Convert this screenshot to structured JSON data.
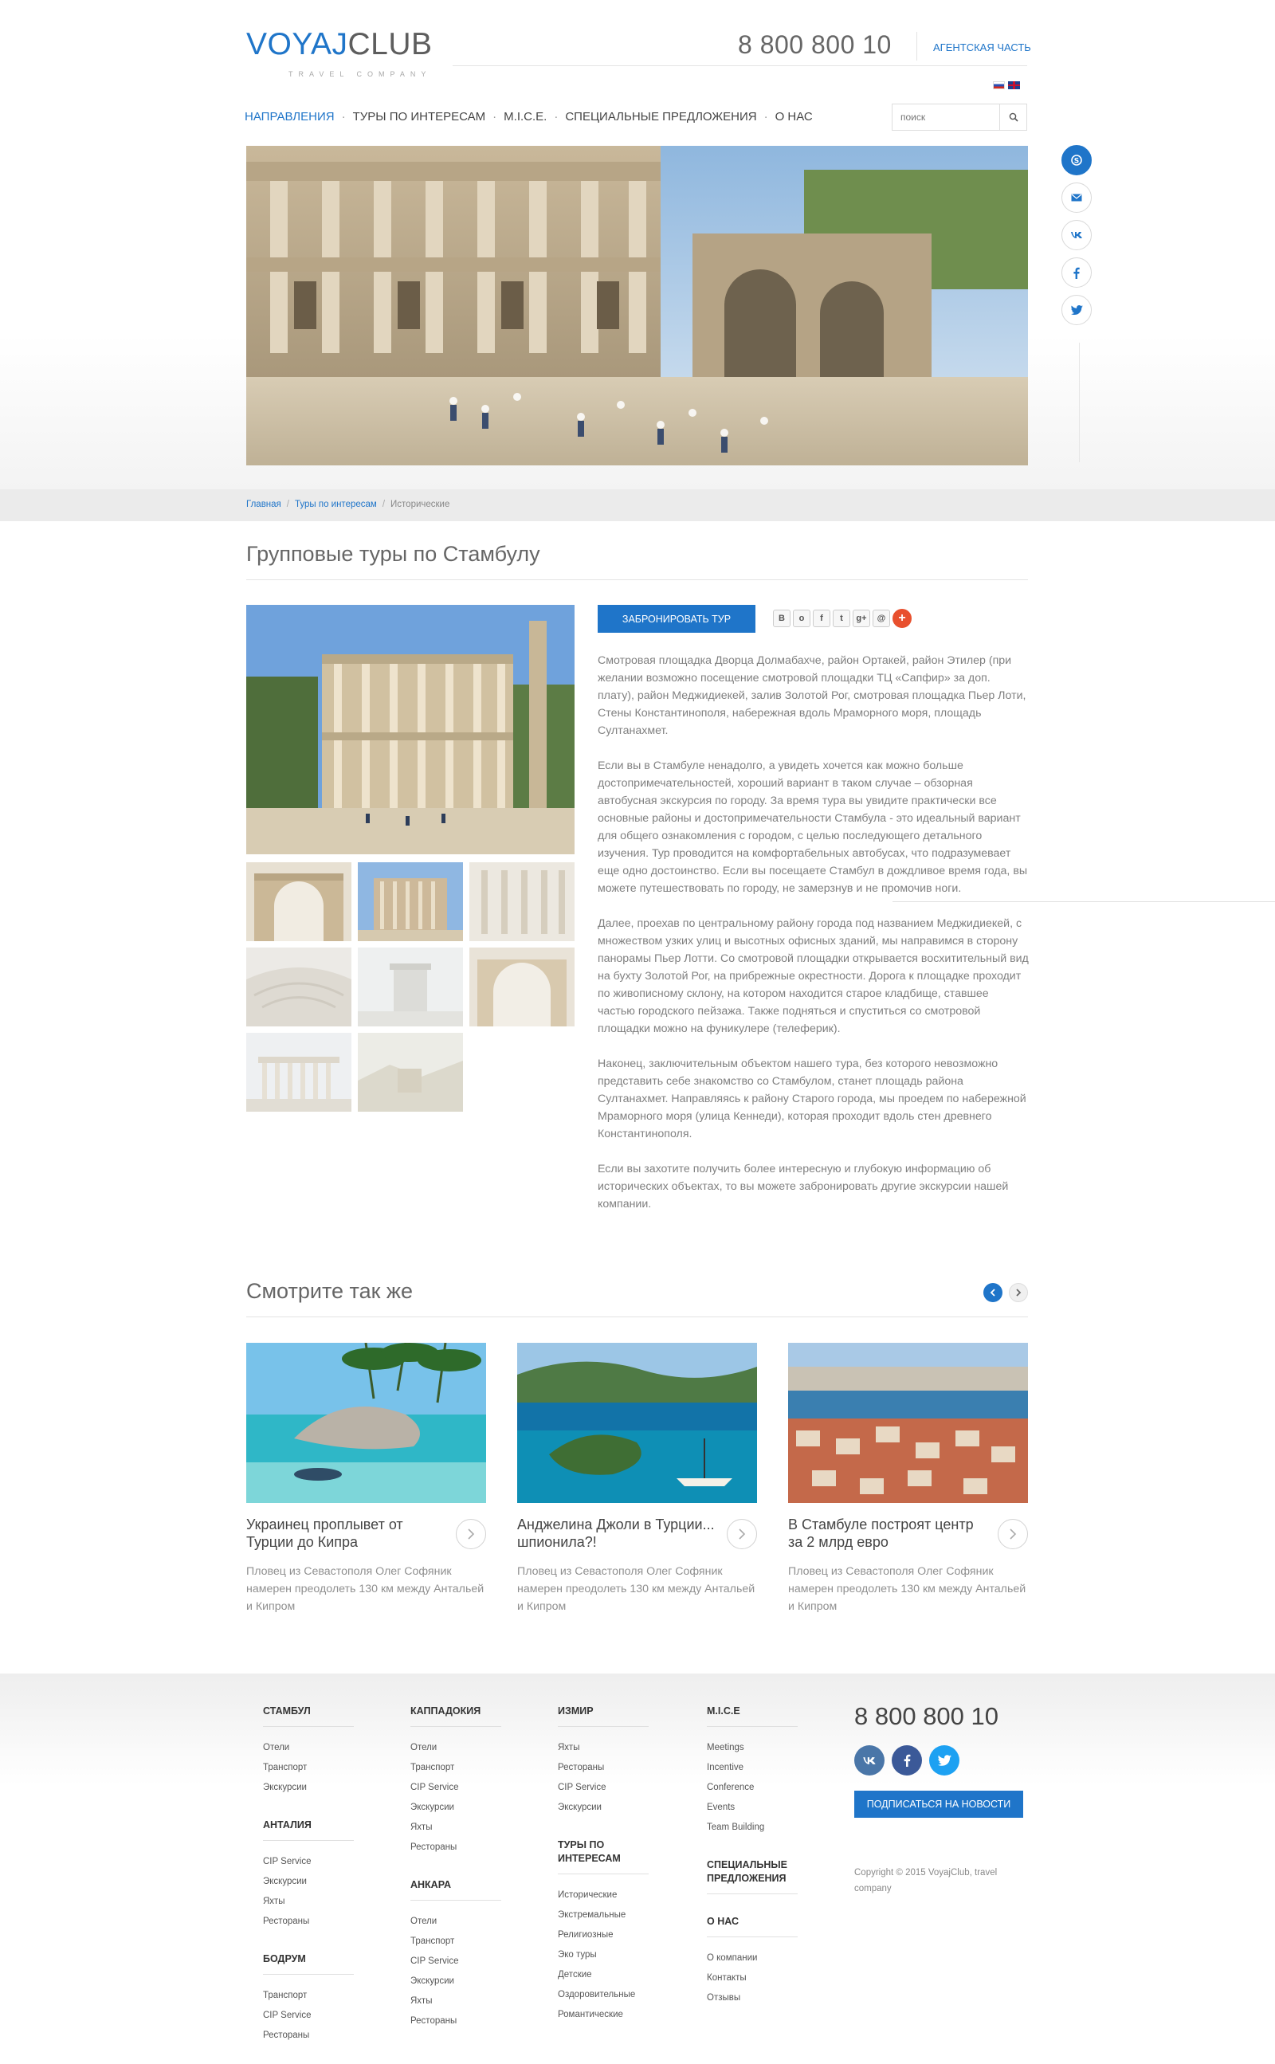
{
  "header": {
    "logo_left": "VOYAJ",
    "logo_right": "CLUB",
    "tagline": "TRAVEL COMPANY",
    "phone": "8 800 800 10",
    "agent_link": "Агентская часть"
  },
  "nav": {
    "items": [
      {
        "label": "Направления",
        "active": true
      },
      {
        "label": "Туры по интересам"
      },
      {
        "label": "M.I.C.E."
      },
      {
        "label": "Специальные предложения"
      },
      {
        "label": "О нас"
      }
    ],
    "search_placeholder": "поиск"
  },
  "breadcrumbs": {
    "home": "Главная",
    "section": "Туры по интересам",
    "current": "Исторические"
  },
  "page": {
    "title": "Групповые туры по Стамбулу",
    "book_button": "Забронировать тур",
    "share_buttons": [
      "В",
      "о",
      "f",
      "t",
      "g+",
      "@",
      "+"
    ],
    "paragraphs": [
      "Смотровая площадка Дворца Долмабахче, район Ортакей, район Этилер (при желании возможно посещение смотровой площадки ТЦ «Сапфир» за доп. плату), район Меджидиекей, залив Золотой Рог, смотровая площадка Пьер Лоти, Стены Константинополя, набережная вдоль Мраморного моря, площадь Султанахмет.",
      "Если вы в Стамбуле ненадолго, а увидеть хочется как можно больше достопримечательностей, хороший вариант в таком случае – обзорная автобусная экскурсия по городу. За время тура вы увидите практически все основные районы и достопримечательности Стамбула - это идеальный вариант для общего ознакомления с городом, с целью последующего детального изучения. Тур проводится на комфортабельных автобусах, что подразумевает еще одно достоинство. Если вы посещаете Стамбул в дождливое время года, вы можете путешествовать по городу, не замерзнув и не промочив ноги.",
      "Далее, проехав по центральному району города под названием Меджидиекей, с множеством узких улиц и высотных офисных зданий, мы направимся в сторону панорамы Пьер Лотти. Со смотровой площадки открывается восхитительный вид на бухту Золотой Рог, на прибрежные окрестности. Дорога к площадке проходит по живописному склону, на котором находится старое кладбище, ставшее частью городского пейзажа. Также подняться и спуститься со смотровой площадки можно на фуникулере (телеферик).",
      "Наконец, заключительным объектом нашего тура, без которого невозможно представить себе знакомство со Стамбулом, станет площадь района Султанахмет. Направляясь к району Старого города, мы проедем по набережной Мраморного моря (улица Кеннеди), которая проходит вдоль стен древнего Константинополя.",
      "Если вы захотите получить более интересную и глубокую информацию об исторических объектах, то вы можете забронировать другие экскурсии нашей компании."
    ]
  },
  "see_also": {
    "title": "Смотрите так же",
    "cards": [
      {
        "title": "Украинец проплывет от Турции до Кипра",
        "desc": "Пловец из Севастополя Олег Софяник намерен преодолеть 130 км между Антальей и Кипром"
      },
      {
        "title": "Анджелина Джоли в Турции... шпионила?!",
        "desc": "Пловец из Севастополя Олег Софяник намерен преодолеть 130 км между Антальей и Кипром"
      },
      {
        "title": "В Стамбуле построят центр за 2 млрд евро",
        "desc": "Пловец из Севастополя Олег Софяник намерен преодолеть 130 км между Антальей и Кипром"
      }
    ]
  },
  "footer": {
    "columns": [
      {
        "groups": [
          {
            "head": "Стамбул",
            "links": [
              "Отели",
              "Транспорт",
              "Экскурсии"
            ]
          },
          {
            "head": "Анталия",
            "links": [
              "CIP Service",
              "Экскурсии",
              "Яхты",
              "Рестораны"
            ]
          },
          {
            "head": "Бодрум",
            "links": [
              "Транспорт",
              "CIP Service",
              "Рестораны"
            ]
          }
        ]
      },
      {
        "groups": [
          {
            "head": "Каппадокия",
            "links": [
              "Отели",
              "Транспорт",
              "CIP Service",
              "Экскурсии",
              "Яхты",
              "Рестораны"
            ]
          },
          {
            "head": "Анкара",
            "links": [
              "Отели",
              "Транспорт",
              "CIP Service",
              "Экскурсии",
              "Яхты",
              "Рестораны"
            ]
          }
        ]
      },
      {
        "groups": [
          {
            "head": "Измир",
            "links": [
              "Яхты",
              "Рестораны",
              "CIP Service",
              "Экскурсии"
            ]
          },
          {
            "head": "Туры по интересам",
            "links": [
              "Исторические",
              "Экстремальные",
              "Религиозные",
              "Эко туры",
              "Детские",
              "Оздоровительные",
              "Романтические"
            ]
          }
        ]
      },
      {
        "groups": [
          {
            "head": "M.I.C.E",
            "links": [
              "Meetings",
              "Incentive",
              "Conference",
              "Events",
              "Team Building"
            ]
          },
          {
            "head": "Специальные предложения",
            "links": []
          },
          {
            "head": "О нас",
            "links": [
              "О компании",
              "Контакты",
              "Отзывы"
            ]
          }
        ]
      }
    ],
    "phone": "8 800 800 10",
    "subscribe": "Подписаться на новости",
    "copyright": "Copyright © 2015 VoyajClub, travel company"
  },
  "colors": {
    "accent": "#1f75c9",
    "vk": "#4a76a8",
    "facebook": "#3b5998",
    "twitter": "#1da1f2",
    "share_plus": "#e8502e"
  },
  "icons": {
    "side_social": [
      "skype-icon",
      "mail-icon",
      "vk-icon",
      "facebook-icon",
      "twitter-icon"
    ],
    "footer_social": [
      "vk-icon",
      "facebook-icon",
      "twitter-icon"
    ]
  }
}
